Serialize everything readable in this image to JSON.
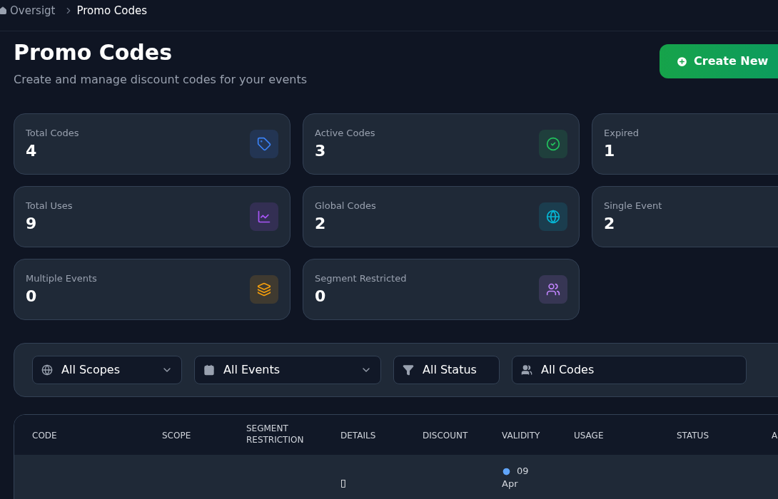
{
  "breadcrumb": [
    {
      "label": "Oversigt",
      "selected": false
    },
    {
      "label": "Promo Codes",
      "selected": true
    }
  ],
  "header": {
    "title": "Promo Codes",
    "subtitle": "Create and manage discount codes for your events",
    "create_button": "Create New"
  },
  "stats": [
    {
      "label": "Total Codes",
      "value": "4"
    },
    {
      "label": "Active Codes",
      "value": "3"
    },
    {
      "label": "Expired",
      "value": "1"
    },
    {
      "label": "Total Uses",
      "value": "9"
    },
    {
      "label": "Global Codes",
      "value": "2"
    },
    {
      "label": "Single Event",
      "value": "2"
    },
    {
      "label": "Multiple Events",
      "value": "0"
    },
    {
      "label": "Segment Restricted",
      "value": "0"
    }
  ],
  "filters": [
    {
      "label": "All Scopes"
    },
    {
      "label": "All Events"
    },
    {
      "label": "All Status"
    },
    {
      "label": "All Codes"
    }
  ],
  "table": {
    "columns": [
      "CODE",
      "SCOPE",
      "SEGMENT RESTRICTION",
      "DETAILS",
      "DISCOUNT",
      "VALIDITY",
      "USAGE",
      "STATUS",
      "A"
    ],
    "rows": [
      {
        "details": "▯",
        "validity_day": "09",
        "validity_month": "Apr"
      }
    ]
  }
}
